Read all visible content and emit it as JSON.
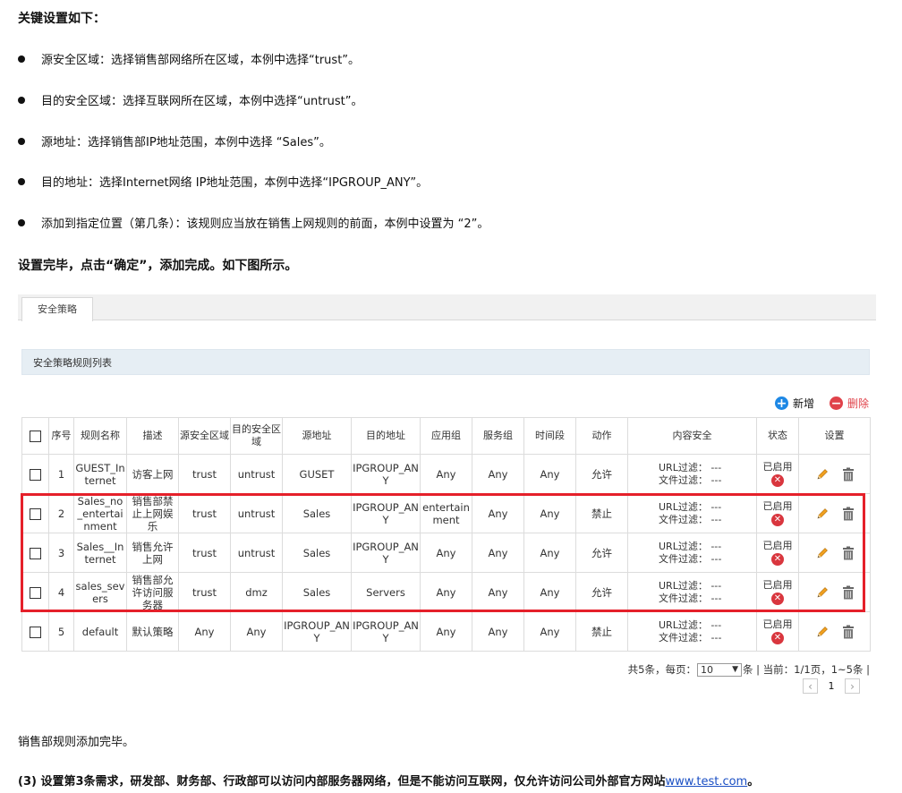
{
  "doc": {
    "heading": "关键设置如下：",
    "bullets": [
      "源安全区域：选择销售部网络所在区域，本例中选择“trust”。",
      "目的安全区域：选择互联网所在区域，本例中选择“untrust”。",
      "源地址：选择销售部IP地址范围，本例中选择 “Sales”。",
      "目的地址：选择Internet网络 IP地址范围，本例中选择“IPGROUP_ANY”。",
      "添加到指定位置（第几条）：该规则应当放在销售上网规则的前面，本例中设置为 “2”。"
    ],
    "done_text": "设置完毕，点击“确定”，添加完成。如下图所示。",
    "finish_text": "销售部规则添加完毕。",
    "step3_text": "(3) 设置第3条需求，研发部、财务部、行政部可以访问内部服务器网络，但是不能访问互联网，仅允许访问公司外部官方网站",
    "step3_link": "www.test.com",
    "step3_end": "。"
  },
  "ui": {
    "tab_label": "安全策略",
    "list_title": "安全策略规则列表",
    "add_label": "新增",
    "delete_label": "删除",
    "columns": [
      "序号",
      "规则名称",
      "描述",
      "源安全区域",
      "目的安全区域",
      "源地址",
      "目的地址",
      "应用组",
      "服务组",
      "时间段",
      "动作",
      "内容安全",
      "状态",
      "设置"
    ],
    "url_filter_label": "URL过滤：",
    "file_filter_label": "文件过滤：",
    "rows": [
      {
        "no": "1",
        "name": "GUEST_Internet",
        "desc": "访客上网",
        "src_zone": "trust",
        "dst_zone": "untrust",
        "src_addr": "GUSET",
        "dst_addr": "IPGROUP_ANY",
        "app": "Any",
        "service": "Any",
        "time": "Any",
        "action": "允许",
        "url": "---",
        "file": "---",
        "status": "已启用"
      },
      {
        "no": "2",
        "name": "Sales_no_entertainment",
        "desc": "销售部禁止上网娱乐",
        "src_zone": "trust",
        "dst_zone": "untrust",
        "src_addr": "Sales",
        "dst_addr": "IPGROUP_ANY",
        "app": "entertainment",
        "service": "Any",
        "time": "Any",
        "action": "禁止",
        "url": "---",
        "file": "---",
        "status": "已启用"
      },
      {
        "no": "3",
        "name": "Sales__Internet",
        "desc": "销售允许上网",
        "src_zone": "trust",
        "dst_zone": "untrust",
        "src_addr": "Sales",
        "dst_addr": "IPGROUP_ANY",
        "app": "Any",
        "service": "Any",
        "time": "Any",
        "action": "允许",
        "url": "---",
        "file": "---",
        "status": "已启用"
      },
      {
        "no": "4",
        "name": "sales_severs",
        "desc": "销售部允许访问服务器",
        "src_zone": "trust",
        "dst_zone": "dmz",
        "src_addr": "Sales",
        "dst_addr": "Servers",
        "app": "Any",
        "service": "Any",
        "time": "Any",
        "action": "允许",
        "url": "---",
        "file": "---",
        "status": "已启用"
      },
      {
        "no": "5",
        "name": "default",
        "desc": "默认策略",
        "src_zone": "Any",
        "dst_zone": "Any",
        "src_addr": "IPGROUP_ANY",
        "dst_addr": "IPGROUP_ANY",
        "app": "Any",
        "service": "Any",
        "time": "Any",
        "action": "禁止",
        "url": "---",
        "file": "---",
        "status": "已启用"
      }
    ],
    "pager": {
      "total_text": "共5条，每页：",
      "per_page": "10",
      "unit_text": "条 | 当前：1/1页，1~5条 |",
      "current_page": "1"
    },
    "colors": {
      "accent_blue": "#1e88e5",
      "delete_red": "#e0424a",
      "highlight_red": "#e5202a",
      "status_x": "#d9363e",
      "pencil": "#f0a020"
    },
    "icons": [
      "add-circle-icon",
      "minus-circle-icon",
      "x-circle-icon",
      "pencil-icon",
      "trash-icon",
      "chevron-left-icon",
      "chevron-right-icon",
      "dropdown-arrow-icon"
    ]
  }
}
